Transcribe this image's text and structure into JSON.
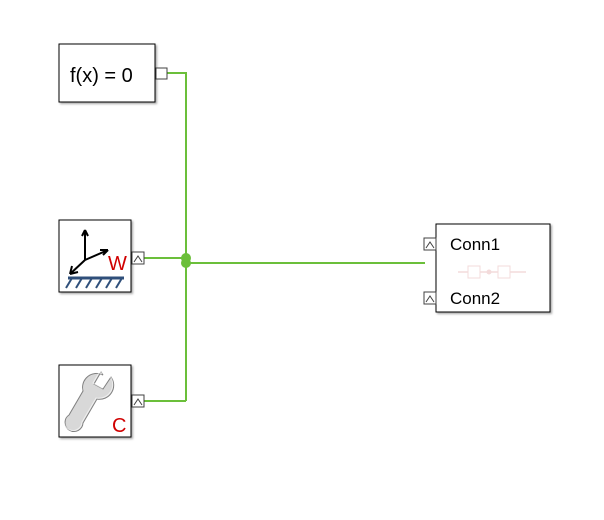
{
  "blocks": {
    "solver": {
      "label": "f(x) = 0"
    },
    "world": {
      "portLabel": "W"
    },
    "mechanism": {
      "portLabel": "C"
    },
    "conn": {
      "port1": "Conn1",
      "port2": "Conn2"
    }
  }
}
